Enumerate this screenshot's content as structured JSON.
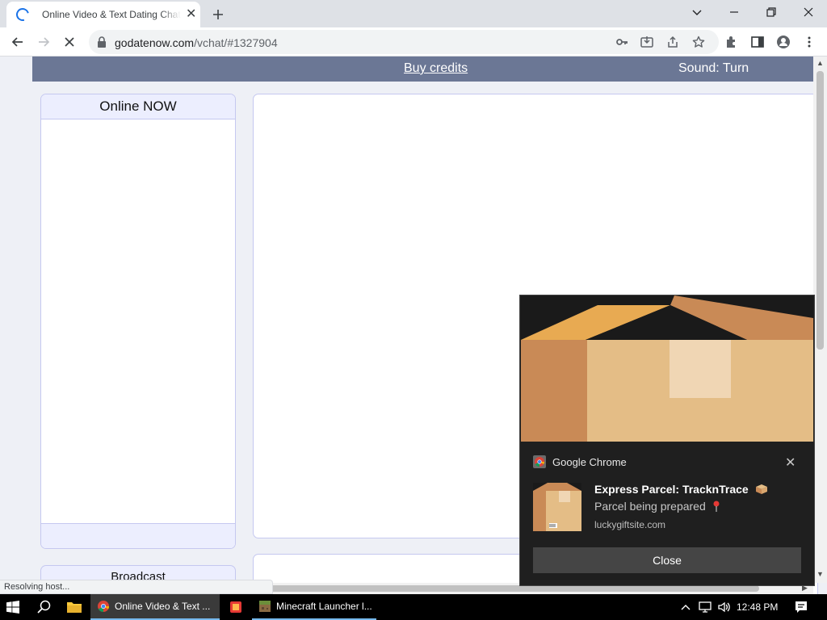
{
  "browser": {
    "tab_title": "Online Video & Text Dating Chat",
    "url_host": "godatenow.com",
    "url_path": "/vchat/#1327904",
    "status_text": "Resolving host..."
  },
  "site": {
    "buy_credits": "Buy credits",
    "sound_label": "Sound: Turn",
    "online_header": "Online NOW",
    "broadcast_header": "Broadcast"
  },
  "notification": {
    "app_name": "Google Chrome",
    "title": "Express Parcel: TracknTrace",
    "body": "Parcel being prepared",
    "site": "luckygiftsite.com",
    "close_label": "Close"
  },
  "taskbar": {
    "chrome_window": "Online Video & Text ...",
    "minecraft_window": "Minecraft Launcher l...",
    "clock": "12:48 PM"
  },
  "colors": {
    "site_bar": "#6b7795",
    "panel_border": "#c5c8f0",
    "panel_header": "#eceefe",
    "notification_bg": "#1f1f1f",
    "notification_button": "#454545"
  },
  "icons": [
    "loading-spinner-icon",
    "close-icon",
    "plus-icon",
    "chevron-down-icon",
    "minimize-icon",
    "restore-icon",
    "back-arrow-icon",
    "forward-arrow-icon",
    "stop-icon",
    "lock-icon",
    "key-icon",
    "install-icon",
    "share-icon",
    "star-icon",
    "puzzle-icon",
    "side-panel-icon",
    "profile-icon",
    "more-vert-icon",
    "parcel-box-icon",
    "pin-icon",
    "chrome-logo-icon",
    "windows-start-icon",
    "search-icon",
    "folder-icon",
    "minecraft-icon",
    "chevron-up-icon",
    "network-icon",
    "volume-icon",
    "notification-center-icon"
  ]
}
